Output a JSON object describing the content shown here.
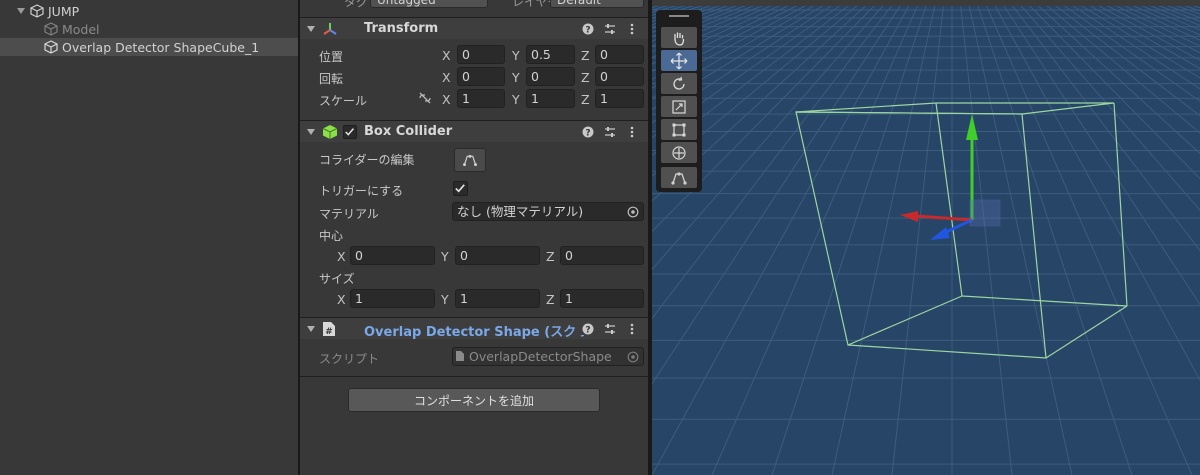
{
  "hierarchy": {
    "items": [
      {
        "label": "JUMP"
      },
      {
        "label": "Model"
      },
      {
        "label": "Overlap Detector ShapeCube_1"
      }
    ]
  },
  "inspector": {
    "top": {
      "tag_value": "Untagged",
      "layer_value": "Default",
      "tag_label": "タグ",
      "layer_label": "レイヤー"
    },
    "transform": {
      "title": "Transform",
      "position_label": "位置",
      "rotation_label": "回転",
      "scale_label": "スケール",
      "position": {
        "x": "0",
        "y": "0.5",
        "z": "0"
      },
      "rotation": {
        "x": "0",
        "y": "0",
        "z": "0"
      },
      "scale": {
        "x": "1",
        "y": "1",
        "z": "1"
      }
    },
    "box_collider": {
      "title": "Box Collider",
      "edit_label": "コライダーの編集",
      "trigger_label": "トリガーにする",
      "material_label": "マテリアル",
      "material_value": "なし (物理マテリアル)",
      "center_label": "中心",
      "size_label": "サイズ",
      "center": {
        "x": "0",
        "y": "0",
        "z": "0"
      },
      "size": {
        "x": "1",
        "y": "1",
        "z": "1"
      }
    },
    "script_comp": {
      "title": "Overlap Detector Shape (スクリプト)",
      "script_label": "スクリプト",
      "script_value": "OverlapDetectorShape"
    },
    "add_component": "コンポーネントを追加",
    "axis_x": "X",
    "axis_y": "Y",
    "axis_z": "Z"
  },
  "colors": {
    "scene_bg": "#274566",
    "wire": "#a8e6a8",
    "gizmo_y": "#3fce2a",
    "gizmo_x": "#c72a2a",
    "gizmo_z": "#2056e0",
    "accent": "#7aa8e8"
  }
}
